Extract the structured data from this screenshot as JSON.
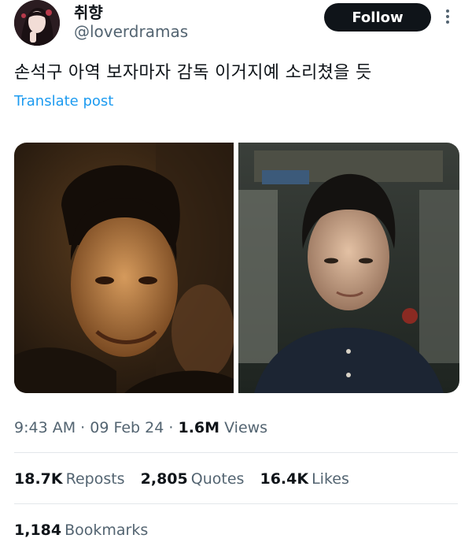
{
  "author": {
    "display_name": "취향",
    "handle": "@loverdramas"
  },
  "follow_label": "Follow",
  "post": {
    "text": "손석구 아역 보자마자 감독 이거지예 소리쳤을 듯",
    "translate_label": "Translate post"
  },
  "meta": {
    "time": "9:43 AM",
    "separator": "·",
    "date": "09 Feb 24",
    "views_count": "1.6M",
    "views_label": "Views"
  },
  "stats": {
    "reposts_count": "18.7K",
    "reposts_label": "Reposts",
    "quotes_count": "2,805",
    "quotes_label": "Quotes",
    "likes_count": "16.4K",
    "likes_label": "Likes",
    "bookmarks_count": "1,184",
    "bookmarks_label": "Bookmarks"
  },
  "icons": {
    "more": "more-vertical-icon"
  },
  "colors": {
    "text_primary": "#0f1419",
    "text_secondary": "#536471",
    "link": "#1d9bf0",
    "button_bg": "#0f1419",
    "divider": "#e3e7ea"
  }
}
